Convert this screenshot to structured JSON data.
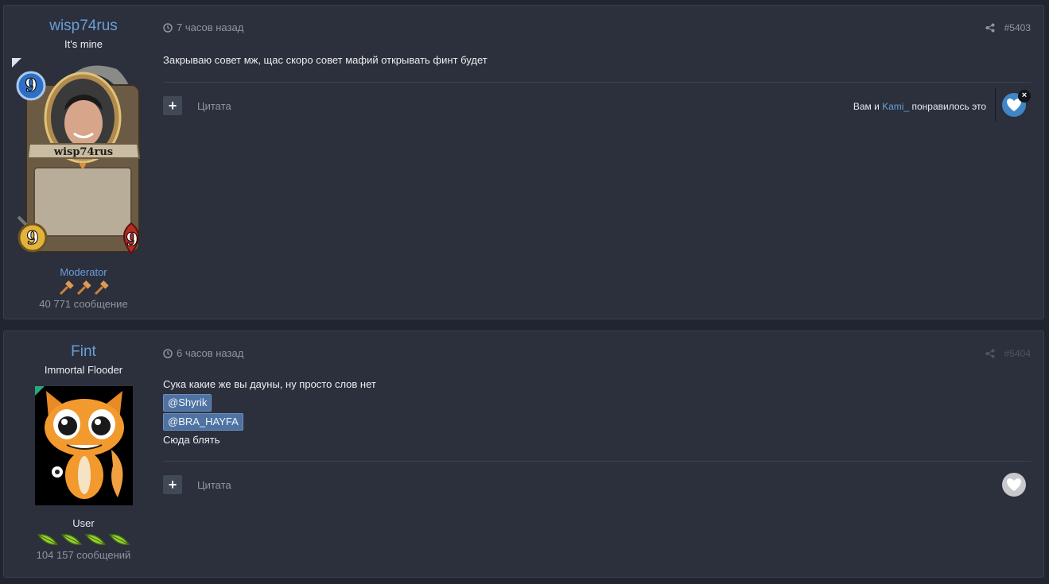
{
  "posts": [
    {
      "author": "wisp74rus",
      "author_title": "It's mine",
      "card": {
        "name": "wisp74rus",
        "mana": "9",
        "attack": "9",
        "health": "9"
      },
      "rank": "Moderator",
      "post_count": "40 771 сообщение",
      "time": "7 часов назад",
      "post_number": "#5403",
      "text_lines": [
        "Закрываю совет мж, щас скоро совет мафий открывать финт будет"
      ],
      "quote_label": "Цитата",
      "likes": {
        "prefix": "Вам и ",
        "user": "Kami_",
        "suffix": " понравилось это"
      },
      "close_label": "×"
    },
    {
      "author": "Fint",
      "author_title": "Immortal Flooder",
      "rank": "User",
      "post_count": "104 157 сообщений",
      "time": "6 часов назад",
      "post_number": "#5404",
      "text_lines": [
        "Сука какие же вы дауны, ну просто слов нет"
      ],
      "mentions": [
        "@Shyrik",
        "@BRA_HAYFA"
      ],
      "text_after": "Сюда блять",
      "quote_label": "Цитата"
    }
  ],
  "colors": {
    "accent": "#6a9fd8",
    "bg": "#212530",
    "panel": "#2b303c",
    "like_active": "#3e86c6",
    "mention_bg": "#4e73a3"
  },
  "icons": {
    "clock": "clock-icon",
    "share": "share-icon",
    "heart": "heart-icon",
    "plus": "plus-icon",
    "gavel": "gavel-icon",
    "leaf": "leaf-icon"
  }
}
